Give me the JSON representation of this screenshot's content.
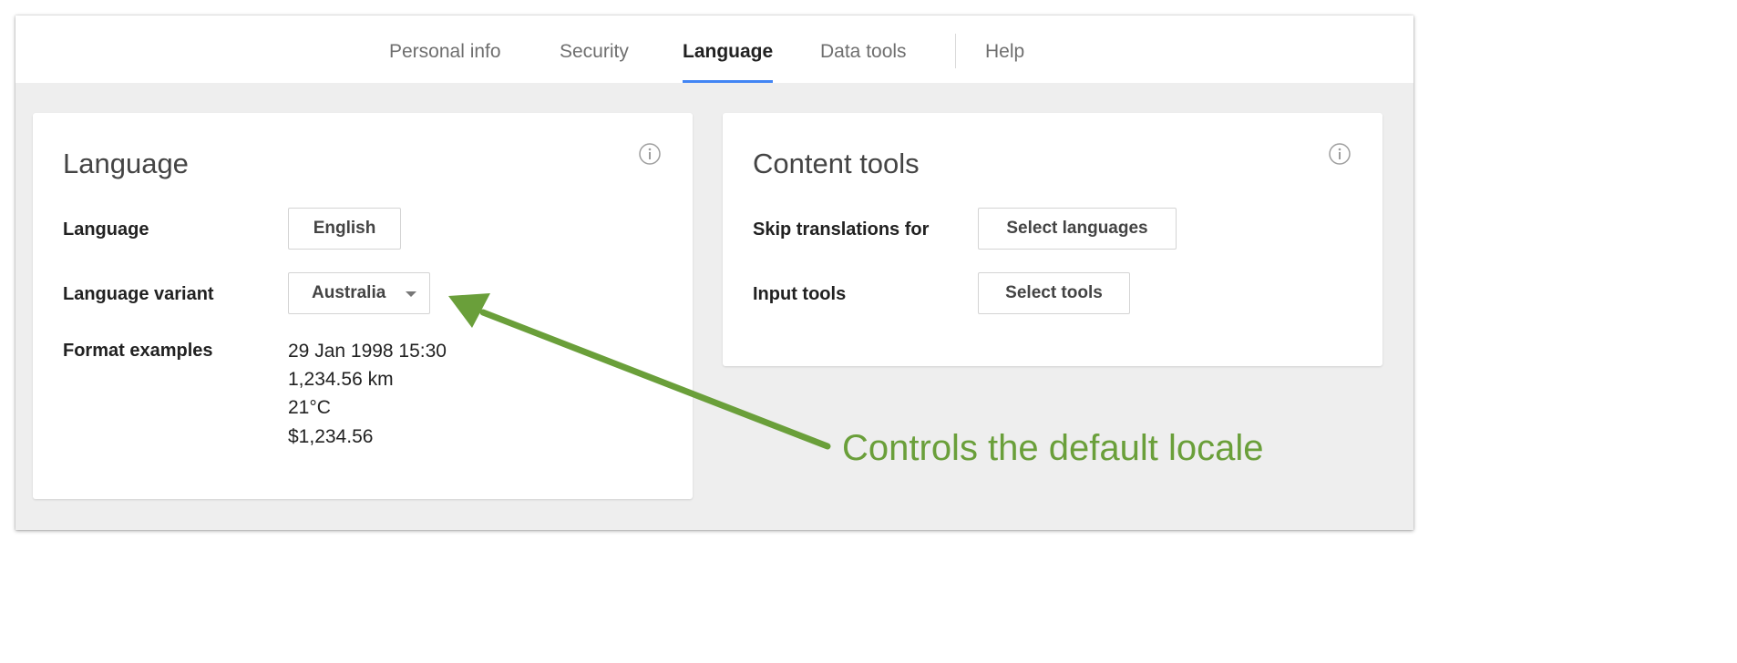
{
  "nav": {
    "tabs": [
      {
        "label": "Personal info",
        "active": false
      },
      {
        "label": "Security",
        "active": false
      },
      {
        "label": "Language",
        "active": true
      },
      {
        "label": "Data tools",
        "active": false
      },
      {
        "label": "Help",
        "active": false
      }
    ]
  },
  "language_card": {
    "title": "Language",
    "language_label": "Language",
    "language_value": "English",
    "variant_label": "Language variant",
    "variant_value": "Australia",
    "format_label": "Format examples",
    "format_examples": [
      "29 Jan 1998 15:30",
      "1,234.56 km",
      "21°C",
      "$1,234.56"
    ]
  },
  "content_card": {
    "title": "Content tools",
    "skip_label": "Skip translations for",
    "skip_button": "Select languages",
    "input_label": "Input tools",
    "input_button": "Select tools"
  },
  "annotation": {
    "text": "Controls the default locale",
    "color": "#6a9f3a"
  },
  "colors": {
    "accent": "#4285f4",
    "background": "#eeeeee"
  },
  "icons": [
    "info-icon",
    "chevron-down-icon",
    "arrow-icon"
  ]
}
